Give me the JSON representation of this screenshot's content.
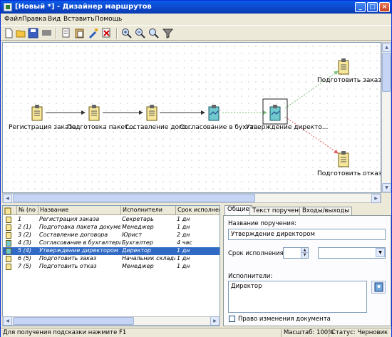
{
  "window": {
    "title": "[Новый *] - Дизайнер маршрутов"
  },
  "menu": [
    "Файл",
    "Правка",
    "Вид",
    "Вставить",
    "Помощь"
  ],
  "toolbar_icons": [
    "new-icon",
    "open-icon",
    "save-icon",
    "flag-icon",
    "copy-icon",
    "paste-icon",
    "tool-icon",
    "cut-icon",
    "zoom-in-icon",
    "zoom-out-icon",
    "zoom-fit-icon",
    "filter-icon"
  ],
  "diagram": {
    "nodes": [
      {
        "label": "Регистрация заказа",
        "kind": "doc"
      },
      {
        "label": "Подготовка пакет...",
        "kind": "doc"
      },
      {
        "label": "Составление дого...",
        "kind": "doc"
      },
      {
        "label": "Согласование в бухга...",
        "kind": "active"
      },
      {
        "label": "Утверждение директо...",
        "kind": "active"
      },
      {
        "label": "Подготовить заказ",
        "kind": "doc"
      },
      {
        "label": "Подготовить отказ",
        "kind": "doc"
      }
    ]
  },
  "table": {
    "headers": [
      "№ (no",
      "Название",
      "Исполнители",
      "Срок исполнени"
    ],
    "rows": [
      [
        "1",
        "Регистрация заказа",
        "Секретарь",
        "1 дн"
      ],
      [
        "2 (1)",
        "Подготовка пакета документ",
        "Менеджер",
        "1 дн"
      ],
      [
        "3 (2)",
        "Составление договора",
        "Юрист",
        "2 дн"
      ],
      [
        "4 (3)",
        "Согласование в бухгалтерии",
        "Бухгалтер",
        "4 час"
      ],
      [
        "5 (4)",
        "Утверждение директором",
        "Директор",
        "1 дн"
      ],
      [
        "6 (5)",
        "Подготовить заказ",
        "Начальник склада",
        "1 дн"
      ],
      [
        "7 (5)",
        "Подготовить отказ",
        "Менеджер",
        "1 дн"
      ]
    ],
    "selected_row": 4
  },
  "props": {
    "tabs": [
      "Общие",
      "Текст поручения",
      "Входы/выходы"
    ],
    "name_label": "Название поручения:",
    "name_value": "Утверждение директором",
    "term_label": "Срок исполнения:",
    "term_value": "",
    "term_unit": "",
    "executors_label": "Исполнители:",
    "executors_value": "Директор",
    "checkbox_label": "Право изменения документа"
  },
  "status": {
    "hint": "Для получения подсказки нажмите F1",
    "zoom": "Масштаб: 100%",
    "state": "Статус: Черновик"
  },
  "colors": {
    "titlebar": "#0d46c8",
    "selection": "#316ac5",
    "accept_line": "#7ac27a",
    "reject_line": "#e06060"
  }
}
